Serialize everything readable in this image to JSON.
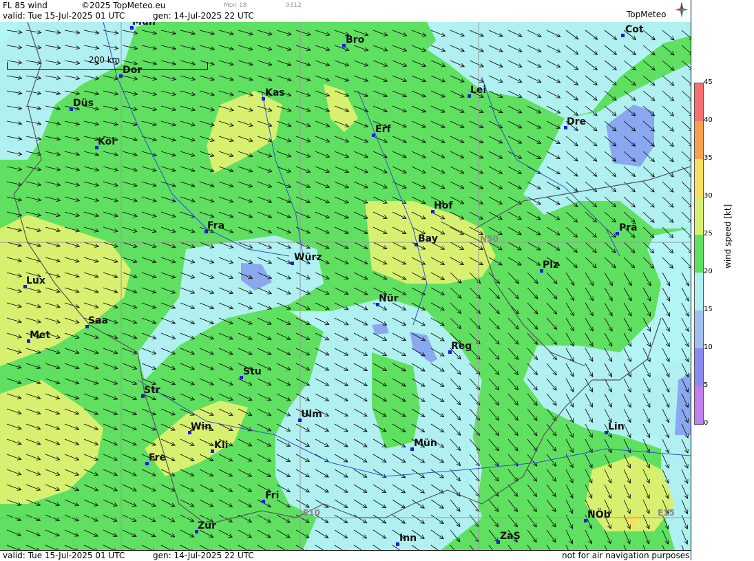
{
  "header": {
    "product": "FL 85 wind",
    "copyright": "©2025 TopMeteo.eu",
    "center_faint": "Mon 18",
    "right_faint": "9312",
    "valid": "valid:  Tue  15-Jul-2025  01 UTC",
    "gen": "gen: 14-Jul-2025 22 UTC",
    "logo": "TopMeteo"
  },
  "footer": {
    "valid": "valid:  Tue  15-Jul-2025  01 UTC",
    "gen": "gen: 14-Jul-2025 22 UTC",
    "disclaimer": "not for air navigation purposes"
  },
  "scale_bar": "200 km",
  "grid_labels": [
    "N50",
    "E10",
    "E15"
  ],
  "legend": {
    "title": "wind  speed  [kt]",
    "ticks": [
      "45",
      "40",
      "35",
      "30",
      "25",
      "20",
      "15",
      "10",
      "5",
      "0"
    ],
    "colors": [
      "#f47070",
      "#f7a050",
      "#f7e060",
      "#d8f070",
      "#60e060",
      "#b0f0f0",
      "#a0c0f0",
      "#8a8af0",
      "#c080f0"
    ]
  },
  "cities": [
    {
      "name": "Mün",
      "id": "muenster"
    },
    {
      "name": "Bro",
      "id": "bro"
    },
    {
      "name": "Cot",
      "id": "cot"
    },
    {
      "name": "Dor",
      "id": "dor"
    },
    {
      "name": "Kas",
      "id": "kas"
    },
    {
      "name": "Lei",
      "id": "lei"
    },
    {
      "name": "Düs",
      "id": "dus"
    },
    {
      "name": "Erf",
      "id": "erf"
    },
    {
      "name": "Dre",
      "id": "dre"
    },
    {
      "name": "Köl",
      "id": "kol"
    },
    {
      "name": "Hof",
      "id": "hof"
    },
    {
      "name": "Fra",
      "id": "fra"
    },
    {
      "name": "Bay",
      "id": "bay"
    },
    {
      "name": "Prä",
      "id": "pra"
    },
    {
      "name": "Würz",
      "id": "wur"
    },
    {
      "name": "Plz",
      "id": "plz"
    },
    {
      "name": "Lux",
      "id": "lux"
    },
    {
      "name": "Nür",
      "id": "nur"
    },
    {
      "name": "Saa",
      "id": "saa"
    },
    {
      "name": "Met",
      "id": "met"
    },
    {
      "name": "Reg",
      "id": "reg"
    },
    {
      "name": "Stu",
      "id": "stu"
    },
    {
      "name": "Str",
      "id": "str"
    },
    {
      "name": "Ulm",
      "id": "ulm"
    },
    {
      "name": "Win",
      "id": "win"
    },
    {
      "name": "Lin",
      "id": "lin"
    },
    {
      "name": "Kli",
      "id": "kli"
    },
    {
      "name": "Mün",
      "id": "munchen"
    },
    {
      "name": "Fre",
      "id": "fre"
    },
    {
      "name": "Fri",
      "id": "fri"
    },
    {
      "name": "NÖb",
      "id": "nob"
    },
    {
      "name": "Zür",
      "id": "zur"
    },
    {
      "name": "ZaS",
      "id": "zas"
    },
    {
      "name": "Inn",
      "id": "inn"
    }
  ]
}
